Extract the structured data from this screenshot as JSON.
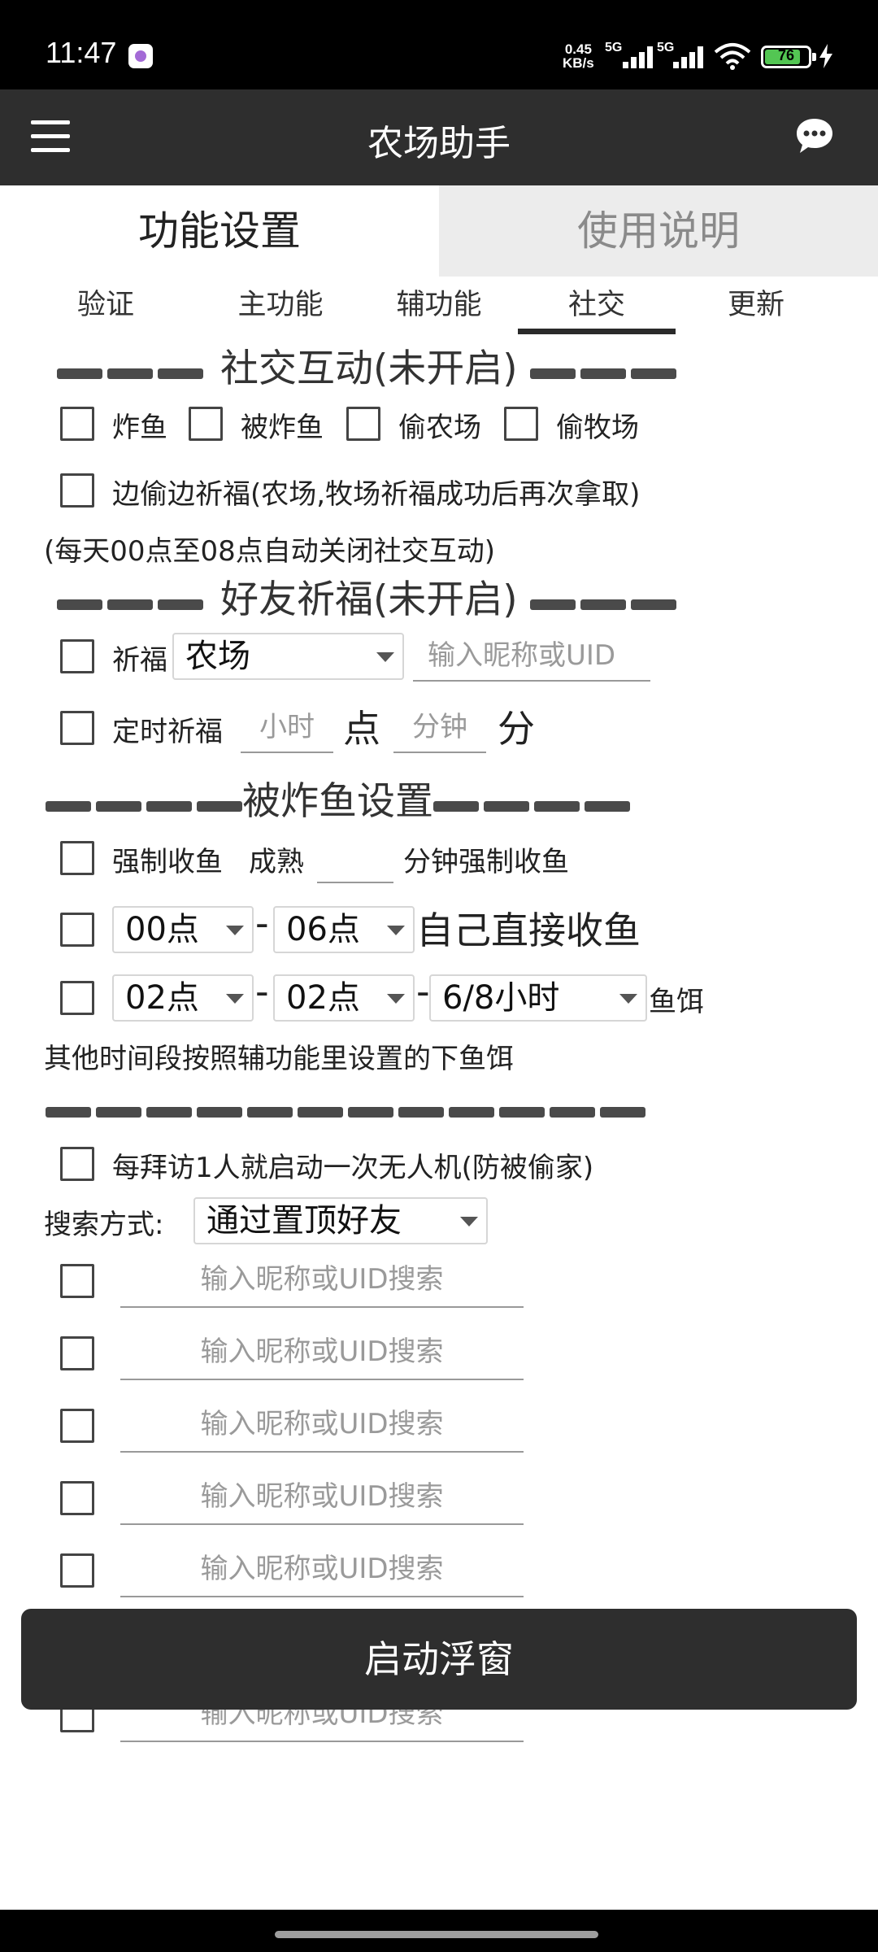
{
  "status_bar": {
    "time": "11:47",
    "net_speed_value": "0.45",
    "net_speed_unit": "KB/s",
    "sim1": "5G",
    "sim2": "5G",
    "battery": "76",
    "icons": [
      "notification-icon",
      "signal-icon",
      "wifi-icon",
      "battery-icon",
      "charging-icon"
    ]
  },
  "app_bar": {
    "title": "农场助手",
    "icons": [
      "menu-icon",
      "chat-icon"
    ]
  },
  "top_tabs": [
    {
      "label": "功能设置",
      "active": true
    },
    {
      "label": "使用说明",
      "active": false
    }
  ],
  "sub_tabs": [
    {
      "label": "验证"
    },
    {
      "label": "主功能"
    },
    {
      "label": "辅功能"
    },
    {
      "label": "社交",
      "active": true
    },
    {
      "label": "更新"
    }
  ],
  "social": {
    "header": "社交互动(未开启)",
    "options": [
      "炸鱼",
      "被炸鱼",
      "偷农场",
      "偷牧场"
    ],
    "bless_while_steal": "边偷边祈福(农场,牧场祈福成功后再次拿取)",
    "note": "(每天00点至08点自动关闭社交互动)"
  },
  "friend_bless": {
    "header": "好友祈福(未开启)",
    "bless_label": "祈福",
    "bless_target": "农场",
    "nickname_placeholder": "输入昵称或UID",
    "timed_label": "定时祈福",
    "hour_placeholder": "小时",
    "hour_unit": "点",
    "minute_placeholder": "分钟",
    "minute_unit": "分"
  },
  "bombed": {
    "header": "被炸鱼设置",
    "force_label": "强制收鱼",
    "ripe_label": "成熟",
    "force_suffix": "分钟强制收鱼",
    "range1_start": "00点",
    "range1_end": "06点",
    "range1_suffix": "自己直接收鱼",
    "range2_start": "02点",
    "range2_end": "02点",
    "bait": "6/8小时",
    "bait_suffix": "鱼饵",
    "dash_sep": "-",
    "note": "其他时间段按照辅功能里设置的下鱼饵"
  },
  "visit": {
    "drone_label": "每拜访1人就启动一次无人机(防被偷家)",
    "search_method_label": "搜索方式:",
    "search_method": "通过置顶好友",
    "search_placeholder": "输入昵称或UID搜索"
  },
  "start_button": "启动浮窗"
}
